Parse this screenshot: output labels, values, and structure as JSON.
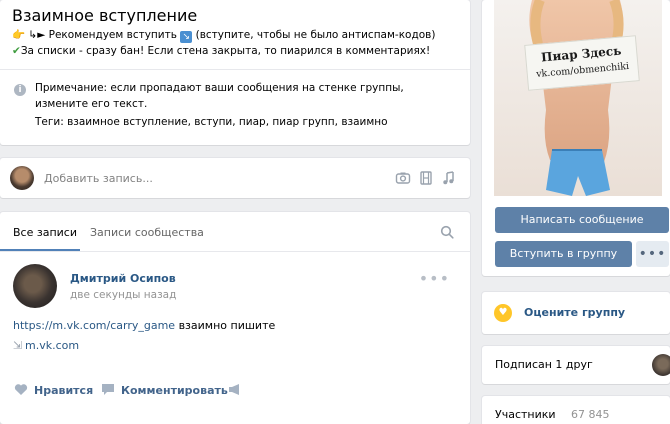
{
  "group": {
    "title": "Взаимное вступление",
    "status_emoji_hand": "👉",
    "status_emoji_arrow": "↳►",
    "status_text_1": " Рекомендуем вступить ",
    "status_emoji_arrow_box": "↘",
    "status_text_2": " (вступите, чтобы не было антиспам-кодов) ",
    "status_emoji_check": "✔",
    "status_text_3": "За списки - сразу бан! Если стена закрыта, то пиарился в комментариях!",
    "note_text": "Примечание: если пропадают ваши сообщения на стенке группы, измените его текст.",
    "tags_text": "Теги: взаимное вступление, вступи, пиар, пиар групп, взаимно"
  },
  "compose": {
    "placeholder": "Добавить запись..."
  },
  "wall": {
    "tab_all": "Все записи",
    "tab_community": "Записи сообщества"
  },
  "post": {
    "author": "Дмитрий Осипов",
    "time": "две секунды назад",
    "link": "https://m.vk.com/carry_game",
    "text": " взаимно пишите",
    "attachment": "m.vk.com",
    "like_label": "Нравится",
    "comment_label": "Комментировать"
  },
  "promo": {
    "sign_title": "Пиар Здесь",
    "sign_url": "vk.com/obmenchiki"
  },
  "actions": {
    "message_button": "Написать сообщение",
    "join_button": "Вступить в группу",
    "more_button": "•••"
  },
  "rate": {
    "label": "Оцените группу"
  },
  "friends": {
    "label": "Подписан 1 друг"
  },
  "members": {
    "label": "Участники",
    "count": "67 845"
  },
  "colors": {
    "accent": "#5e81a8",
    "link": "#2a5885",
    "background": "#edeef0"
  }
}
